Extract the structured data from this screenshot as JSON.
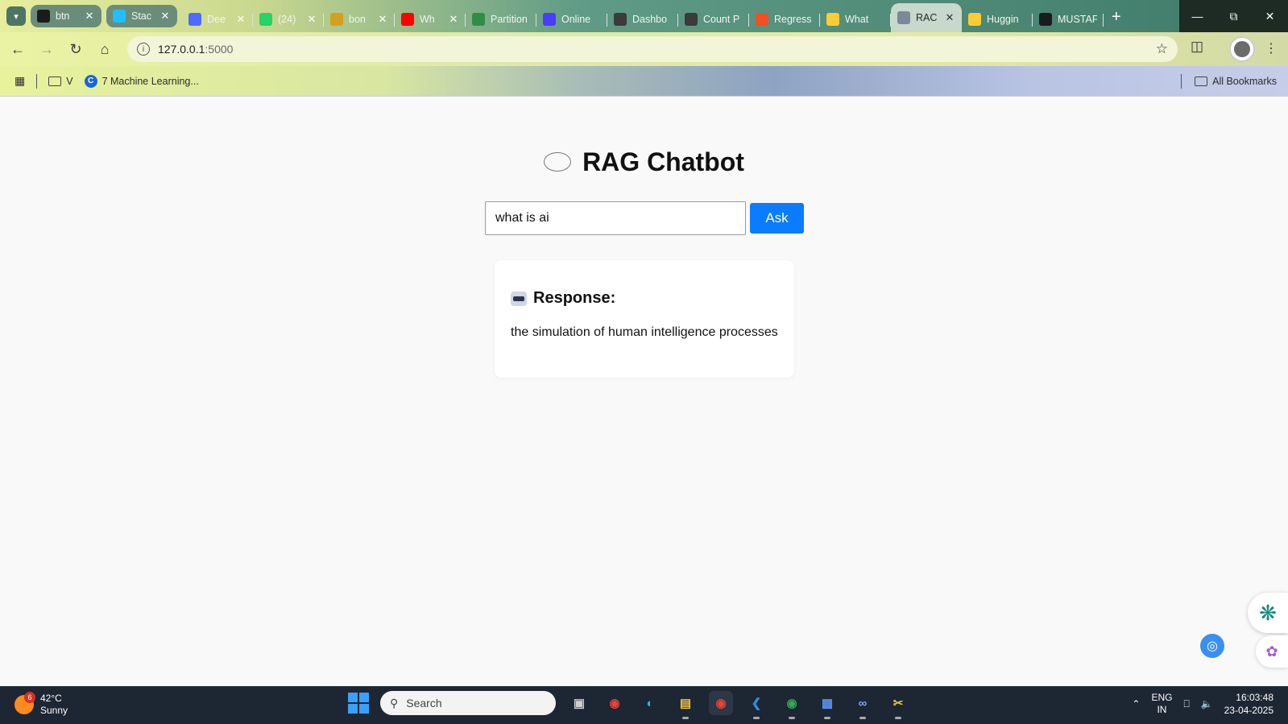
{
  "browser": {
    "tabs": [
      {
        "title": "btn",
        "favicon": "openai-icon",
        "color": "#1b1b1b",
        "style": "pill"
      },
      {
        "title": "Stac",
        "favicon": "kaggle-icon",
        "color": "#20beff",
        "style": "pill"
      },
      {
        "title": "Dee",
        "favicon": "deepseek-icon",
        "color": "#4d6bfe",
        "style": "plain"
      },
      {
        "title": "(24)",
        "favicon": "whatsapp-icon",
        "color": "#25d366",
        "style": "plain"
      },
      {
        "title": "bon",
        "favicon": "hf-spaces-icon",
        "color": "#d4a020",
        "style": "plain"
      },
      {
        "title": "Wh",
        "favicon": "youtube-icon",
        "color": "#ff0000",
        "style": "plain"
      },
      {
        "title": "Partition",
        "favicon": "gfg-icon",
        "color": "#2f8d46",
        "style": "plain"
      },
      {
        "title": "Online",
        "favicon": "online-tool-icon",
        "color": "#4a3cff",
        "style": "plain"
      },
      {
        "title": "Dashbo",
        "favicon": "cc-icon",
        "color": "#3b3b3b",
        "style": "plain"
      },
      {
        "title": "Count P",
        "favicon": "cc-icon",
        "color": "#3b3b3b",
        "style": "plain"
      },
      {
        "title": "Regress",
        "favicon": "microsoft-icon",
        "color": "#f25022",
        "style": "plain"
      },
      {
        "title": "What",
        "favicon": "hf-icon",
        "color": "#ffcc33",
        "style": "plain"
      },
      {
        "title": "RAC",
        "favicon": "globe-icon",
        "color": "#7a8a99",
        "style": "active"
      },
      {
        "title": "Huggin",
        "favicon": "hf-icon",
        "color": "#ffcc33",
        "style": "plain"
      },
      {
        "title": "MUSTAF",
        "favicon": "github-icon",
        "color": "#1b1b1b",
        "style": "plain"
      }
    ],
    "url_host": "127.0.0.1",
    "url_port": ":5000",
    "bookmarks": [
      {
        "label": "V",
        "type": "folder"
      },
      {
        "label": "7 Machine Learning...",
        "type": "link"
      }
    ],
    "all_bookmarks_label": "All Bookmarks"
  },
  "page": {
    "title": "RAG Chatbot",
    "query_value": "what is ai",
    "ask_label": "Ask",
    "response_title": "Response:",
    "response_text": "the simulation of human intelligence processes"
  },
  "taskbar": {
    "weather_temp": "42°C",
    "weather_desc": "Sunny",
    "weather_badge": "6",
    "search_placeholder": "Search",
    "lang_top": "ENG",
    "lang_bottom": "IN",
    "time": "16:03:48",
    "date": "23-04-2025"
  }
}
